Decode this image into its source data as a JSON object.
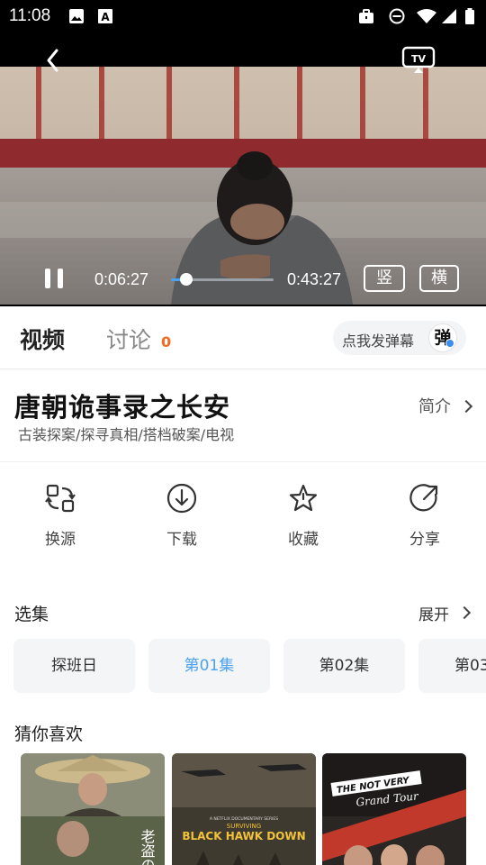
{
  "status_bar": {
    "time": "11:08",
    "icons": [
      "image-icon",
      "a-icon",
      "briefcase-icon",
      "dnd-icon",
      "wifi-icon",
      "signal-icon",
      "battery-icon"
    ]
  },
  "player": {
    "current_time": "0:06:27",
    "duration": "0:43:27",
    "progress_fraction": 0.148,
    "portrait_label": "竖",
    "landscape_label": "横",
    "icons": [
      "back-icon",
      "tv-cast-icon",
      "pause-icon"
    ]
  },
  "tabs": {
    "video": "视频",
    "discussion": "讨论",
    "discussion_count": "0",
    "danmu_button": "点我发弹幕",
    "danmu_icon": "弹"
  },
  "show": {
    "title": "唐朝诡事录之长安",
    "tags": "古装探案/探寻真相/搭档破案/电视",
    "intro_link": "简介"
  },
  "actions": [
    {
      "label": "换源",
      "icon": "switch-source-icon"
    },
    {
      "label": "下载",
      "icon": "download-icon"
    },
    {
      "label": "收藏",
      "icon": "star-icon"
    },
    {
      "label": "分享",
      "icon": "share-icon"
    }
  ],
  "episodes": {
    "title": "选集",
    "expand": "展开",
    "items": [
      "探班日",
      "第01集",
      "第02集",
      "第03"
    ],
    "selected_index": 1
  },
  "recommend": {
    "title": "猜你喜欢",
    "posters": [
      {
        "name": "old-thief-poster",
        "caption": "老盗の"
      },
      {
        "name": "black-hawk-down-poster",
        "top_line": "A NETFLIX DOCUMENTARY SERIES",
        "line1": "SURVIVING",
        "line2": "BLACK HAWK DOWN"
      },
      {
        "name": "grand-tour-poster",
        "line1": "THE NOT VERY",
        "line2": "Grand Tour"
      }
    ]
  },
  "colors": {
    "accent": "#4aa1f0",
    "count_orange": "#f26b1d",
    "chip_bg": "#f4f5f7"
  }
}
